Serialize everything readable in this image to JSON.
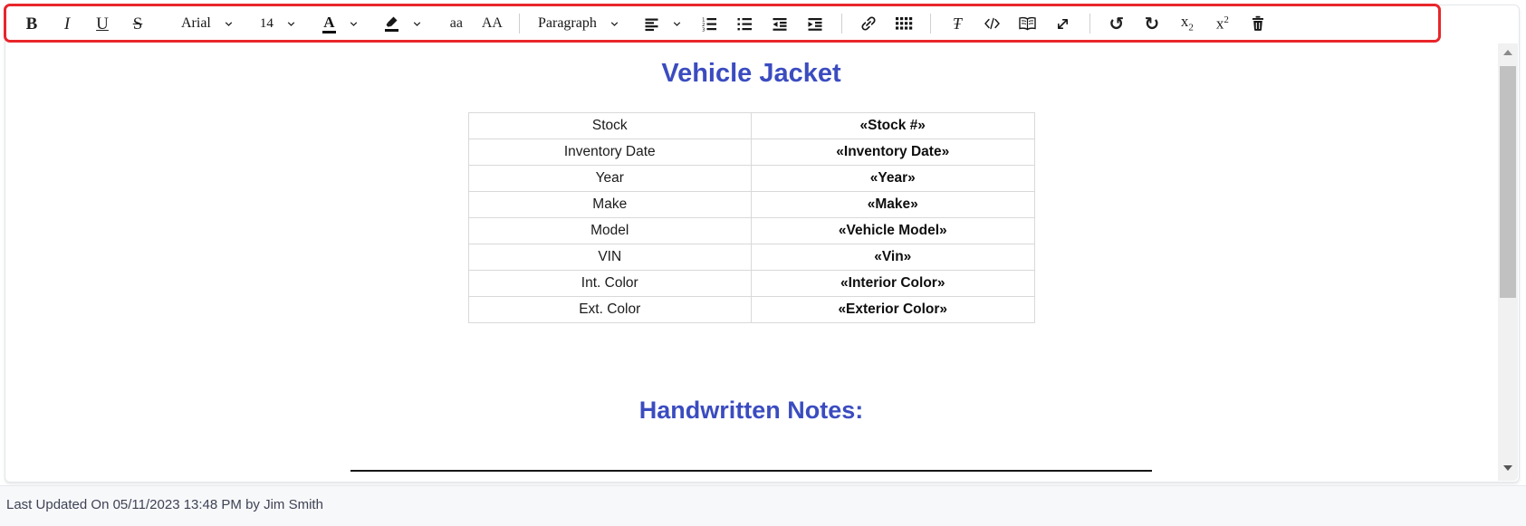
{
  "toolbar": {
    "bold_label": "B",
    "italic_label": "I",
    "underline_label": "U",
    "strikethrough_label": "S",
    "font_family_value": "Arial",
    "font_size_value": "14",
    "text_color_label": "A",
    "lowercase_label": "aa",
    "uppercase_label": "AA",
    "block_format_value": "Paragraph",
    "clear_format_label": "Ŧ",
    "subscript_base": "x",
    "subscript_digit": "2",
    "superscript_base": "x",
    "superscript_digit": "2",
    "undo_glyph": "↺",
    "redo_glyph": "↻"
  },
  "document": {
    "title": "Vehicle Jacket",
    "vehicle_table": {
      "rows": [
        {
          "label": "Stock",
          "value": "«Stock #»"
        },
        {
          "label": "Inventory Date",
          "value": "«Inventory Date»"
        },
        {
          "label": "Year",
          "value": "«Year»"
        },
        {
          "label": "Make",
          "value": "«Make»"
        },
        {
          "label": "Model",
          "value": "«Vehicle Model»"
        },
        {
          "label": "VIN",
          "value": "«Vin»"
        },
        {
          "label": "Int. Color",
          "value": "«Interior Color»"
        },
        {
          "label": "Ext. Color",
          "value": "«Exterior Color»"
        }
      ]
    },
    "notes_heading": "Handwritten Notes:"
  },
  "footer": {
    "last_updated": "Last Updated On 05/11/2023 13:48 PM by Jim Smith"
  },
  "colors": {
    "annotation_red": "#E8262B",
    "heading_blue": "#3B4CC0"
  }
}
